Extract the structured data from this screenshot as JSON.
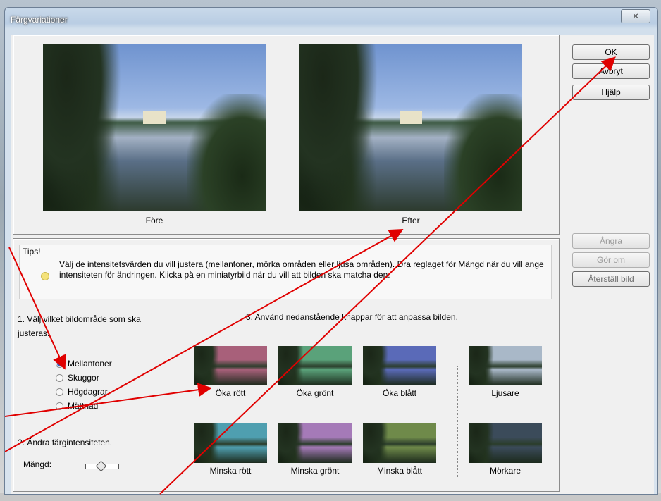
{
  "window": {
    "title": "Färgvariationer",
    "close_label": "⨯"
  },
  "preview": {
    "before_label": "Före",
    "after_label": "Efter"
  },
  "buttons": {
    "ok": "OK",
    "cancel": "Avbryt",
    "help": "Hjälp",
    "undo": "Ångra",
    "redo": "Gör om",
    "reset": "Återställ bild"
  },
  "tips": {
    "header": "Tips!",
    "text": "Välj de intensitetsvärden du vill justera (mellantoner, mörka områden eller ljusa områden). Dra reglaget för Mängd när du vill ange intensiteten för ändringen. Klicka på en miniatyrbild när du vill att bilden ska matcha den."
  },
  "step1": {
    "label": "1. Välj vilket bildområde som ska justeras.",
    "options": [
      {
        "label": "Mellantoner",
        "selected": true
      },
      {
        "label": "Skuggor",
        "selected": false
      },
      {
        "label": "Högdagrar",
        "selected": false
      },
      {
        "label": "Mättnad",
        "selected": false
      }
    ]
  },
  "step2": {
    "label": "2. Ändra färgintensiteten.",
    "amount_label": "Mängd:",
    "amount_value": 0.5
  },
  "step3": {
    "label": "3. Använd nedanstående knappar för att anpassa bilden."
  },
  "thumbs": [
    {
      "label": "Öka rött",
      "tint": "#a8607a"
    },
    {
      "label": "Öka grönt",
      "tint": "#5aa27a"
    },
    {
      "label": "Öka blått",
      "tint": "#5a6ab8"
    },
    {
      "label": "Ljusare",
      "tint": "#a9b8c8"
    },
    {
      "label": "Minska rött",
      "tint": "#4f9fb0"
    },
    {
      "label": "Minska grönt",
      "tint": "#a57ab8"
    },
    {
      "label": "Minska blått",
      "tint": "#6f8a4a"
    },
    {
      "label": "Mörkare",
      "tint": "#3b4b5a"
    }
  ],
  "colors": {
    "arrow": "#e00000"
  }
}
